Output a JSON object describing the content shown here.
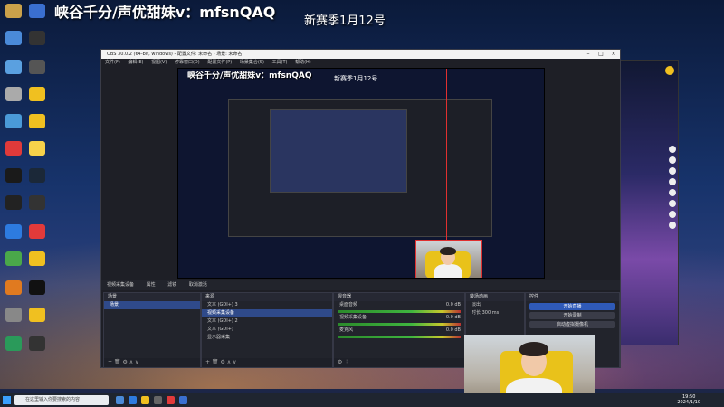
{
  "overlay": {
    "title": "峡谷千分/声优甜妹v：mfsnQAQ",
    "subtitle": "新赛季1月12号"
  },
  "obs": {
    "window_title": "OBS 30.0.2 (64-bit, windows) - 配置文件: 未命名 - 场景: 未命名",
    "menu": [
      "文件(F)",
      "编辑(E)",
      "视图(V)",
      "停靠窗口(D)",
      "配置文件(P)",
      "场景集合(S)",
      "工具(T)",
      "帮助(H)"
    ],
    "preview_title": "峡谷千分/声优甜妹v：mfsnQAQ",
    "preview_sub": "新赛季1月12号",
    "toolbar": {
      "source": "视频采集设备",
      "props": "属性",
      "filters": "滤镜",
      "activate": "取消激活"
    },
    "scenes": {
      "header": "场景",
      "items": [
        "场景"
      ]
    },
    "sources": {
      "header": "来源",
      "items": [
        "文本 (GDI+) 3",
        "视频采集设备",
        "文本 (GDI+) 2",
        "文本 (GDI+)",
        "显示器采集"
      ]
    },
    "mixer": {
      "header": "混音器",
      "tracks": [
        {
          "name": "桌面音频",
          "db": "0.0 dB"
        },
        {
          "name": "视频采集设备",
          "db": "0.0 dB"
        },
        {
          "name": "麦克风",
          "db": "0.0 dB"
        }
      ]
    },
    "transitions": {
      "header": "转场动画",
      "type": "淡出",
      "duration_label": "时长",
      "duration": "300 ms"
    },
    "controls": {
      "header": "控件",
      "start_stream": "开始直播",
      "start_record": "开始录制",
      "virtual_cam": "启动虚拟摄像机"
    }
  },
  "taskbar": {
    "search_placeholder": "在这里输入你要搜索的内容",
    "time": "19:50",
    "date": "2024/1/10"
  },
  "colors": {
    "obs_bg": "#1e1f26",
    "accent": "#2f5ab8",
    "red_guide": "#e03030",
    "chair": "#e9c21a"
  }
}
